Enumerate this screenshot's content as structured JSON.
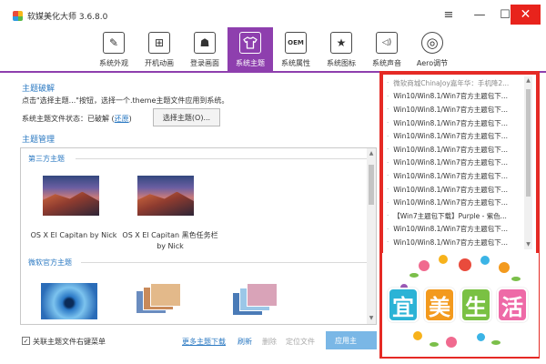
{
  "window": {
    "title": "软媒美化大师 3.6.8.0",
    "controls": {
      "menu": "≡",
      "minimize": "—",
      "maximize": "☐",
      "close": "✕"
    }
  },
  "toolbar": {
    "items": [
      {
        "label": "系统外观",
        "icon": "brush-icon",
        "glyph": "✎"
      },
      {
        "label": "开机动画",
        "icon": "windows-logo-icon",
        "glyph": "⊞"
      },
      {
        "label": "登录画面",
        "icon": "user-portrait-icon",
        "glyph": "☗"
      },
      {
        "label": "系统主题",
        "icon": "tshirt-icon",
        "glyph": "👕",
        "active": true
      },
      {
        "label": "系统属性",
        "icon": "oem-icon",
        "glyph": "OEM"
      },
      {
        "label": "系统图标",
        "icon": "star-icon",
        "glyph": "★"
      },
      {
        "label": "系统声音",
        "icon": "speaker-icon",
        "glyph": "◁)"
      },
      {
        "label": "Aero调节",
        "icon": "target-icon",
        "glyph": "◎"
      }
    ]
  },
  "crack": {
    "title": "主题破解",
    "description": "点击\"选择主题...\"按钮，选择一个.theme主题文件应用到系统。",
    "status_label": "系统主题文件状态：已破解 (",
    "restore_link": "还原",
    "status_close": ")",
    "select_button": "选择主题(O)..."
  },
  "manage": {
    "title": "主题管理",
    "third_party_label": "第三方主题",
    "official_label": "微软官方主题",
    "third_party_themes": [
      {
        "name": "OS X El Capitan by Nick"
      },
      {
        "name": "OS X El Capitan 黑色任务栏 by Nick"
      }
    ]
  },
  "bottom": {
    "associate_checkbox": "关联主题文件右键菜单",
    "checked": true,
    "more_download": "更多主题下载",
    "refresh": "刷新",
    "delete": "删除",
    "locate_file": "定位文件",
    "apply": "应用主"
  },
  "news": {
    "items": [
      "微软商城ChinaJoy嘉年华：手机降2...",
      "Win10/Win8.1/Win7官方主题包下...",
      "Win10/Win8.1/Win7官方主题包下...",
      "Win10/Win8.1/Win7官方主题包下...",
      "Win10/Win8.1/Win7官方主题包下...",
      "Win10/Win8.1/Win7官方主题包下...",
      "Win10/Win8.1/Win7官方主题包下...",
      "Win10/Win8.1/Win7官方主题包下...",
      "Win10/Win8.1/Win7官方主题包下...",
      "Win10/Win8.1/Win7官方主题包下...",
      "【Win7主题包下载】Purple - 紫色...",
      "Win10/Win8.1/Win7官方主题包下...",
      "Win10/Win8.1/Win7官方主题包下..."
    ]
  },
  "watermark": {
    "chars": [
      "宜",
      "美",
      "生",
      "活"
    ],
    "colors": [
      "#2bb3d6",
      "#f39a1e",
      "#7ac143",
      "#ee6aa7"
    ]
  },
  "colors": {
    "accent": "#8e3fae",
    "link": "#2b79c2",
    "close": "#e8231c",
    "highlight_frame": "#e52a25",
    "apply_button": "#7ab7e6"
  }
}
